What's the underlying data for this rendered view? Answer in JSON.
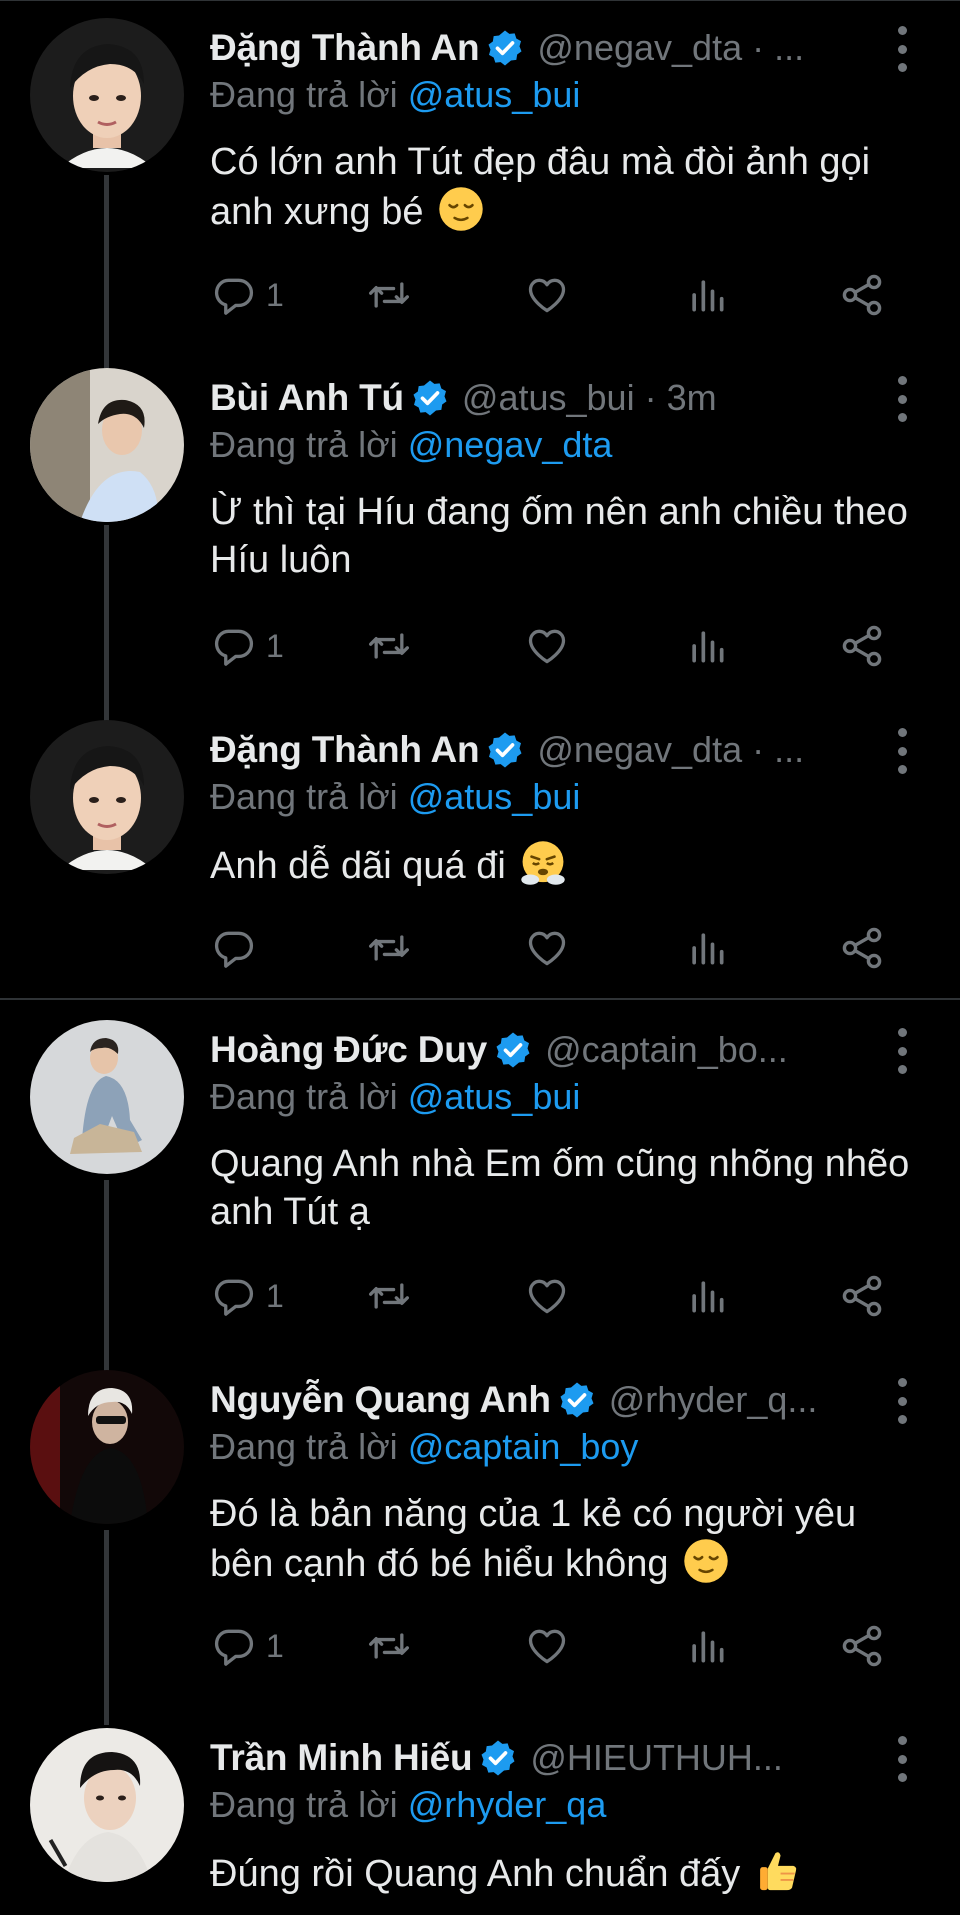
{
  "colors": {
    "background": "#000000",
    "text": "#e7e9ea",
    "muted": "#71767b",
    "link": "#1d9bf0",
    "verified": "#1d9bf0",
    "divider": "#2f3336"
  },
  "reply_prefix": "Đang trả lời",
  "tweets": [
    {
      "name": "Đặng Thành An",
      "handle": "@negav_dta · ...",
      "reply_to": "@atus_bui",
      "text": "Có lớn anh Tút đẹp đâu mà đòi ảnh gọi anh xưng bé",
      "emoji": "relieved-face",
      "reply_count": "1"
    },
    {
      "name": "Bùi Anh Tú",
      "handle": "@atus_bui · 3m",
      "reply_to": "@negav_dta",
      "text": "Ừ thì tại Híu đang ốm nên anh chiều theo Híu luôn",
      "emoji": "",
      "reply_count": "1"
    },
    {
      "name": "Đặng Thành An",
      "handle": "@negav_dta · ...",
      "reply_to": "@atus_bui",
      "text": "Anh dễ dãi quá đi",
      "emoji": "face-with-steam",
      "reply_count": ""
    },
    {
      "name": "Hoàng Đức Duy",
      "handle": "@captain_bo...",
      "reply_to": "@atus_bui",
      "text": "Quang Anh nhà Em ốm cũng nhõng nhẽo anh Tút ạ",
      "emoji": "",
      "reply_count": "1"
    },
    {
      "name": "Nguyễn Quang Anh",
      "handle": "@rhyder_q...",
      "reply_to": "@captain_boy",
      "text": "Đó là bản năng của 1 kẻ có người yêu bên cạnh đó bé hiểu không",
      "emoji": "relieved-face",
      "reply_count": "1"
    },
    {
      "name": "Trần Minh Hiếu",
      "handle": "@HIEUTHUH...",
      "reply_to": "@rhyder_qa",
      "text": "Đúng rồi Quang Anh chuẩn đấy",
      "emoji": "thumbs-up",
      "reply_count": ""
    }
  ]
}
